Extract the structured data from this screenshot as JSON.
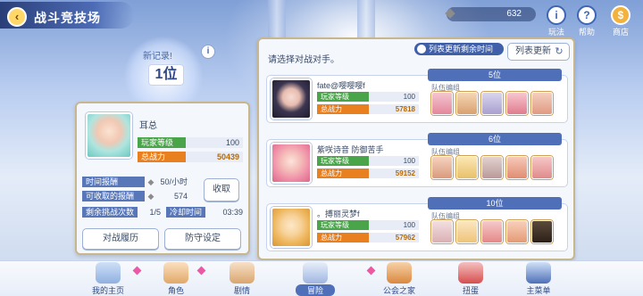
{
  "header": {
    "title": "战斗竞技场",
    "currency_value": "632",
    "icons": [
      {
        "name": "play-info",
        "label": "玩法",
        "glyph": "i"
      },
      {
        "name": "help",
        "label": "帮助",
        "glyph": "?"
      },
      {
        "name": "shop",
        "label": "商店",
        "glyph": "$"
      }
    ]
  },
  "record": {
    "label": "新记录!",
    "rank": "1位"
  },
  "player": {
    "name": "耳总",
    "level_label": "玩家等级",
    "level": "100",
    "power_label": "总战力",
    "power": "50439"
  },
  "rewards": {
    "time_reward_label": "时间报酬",
    "time_reward_value": "50/小时",
    "claimable_label": "可收取的报酬",
    "claimable_value": "574",
    "remaining_label": "剩余挑战次数",
    "remaining_value": "1/5",
    "cooldown_label": "冷却时间",
    "cooldown_value": "03:39",
    "claim_label": "收取"
  },
  "buttons": {
    "history": "对战履历",
    "defense": "防守设定"
  },
  "opponents_panel": {
    "prompt": "请选择对战对手。",
    "timer_label": "列表更新剩余时间",
    "refresh_label": "列表更新",
    "team_label": "队伍编组",
    "level_label": "玩家等级",
    "power_label": "总战力",
    "list": [
      {
        "rank": "5位",
        "name": "fate@嘤嘤嘤f",
        "level": "100",
        "power": "57818"
      },
      {
        "rank": "6位",
        "name": "紫咲诗音 防御苦手",
        "level": "100",
        "power": "59152"
      },
      {
        "rank": "10位",
        "name": "。搏丽灵梦f",
        "level": "100",
        "power": "57962"
      }
    ]
  },
  "nav": {
    "items": [
      {
        "label": "我的主页"
      },
      {
        "label": "角色"
      },
      {
        "label": "剧情"
      },
      {
        "label": "冒险"
      },
      {
        "label": "公会之家"
      },
      {
        "label": "扭蛋"
      },
      {
        "label": "主菜单"
      }
    ]
  },
  "colors": {
    "accent": "#4f70b8",
    "level_bar": "#4aa54a",
    "power_bar": "#e9801f",
    "panel_border": "#c8b78c"
  }
}
